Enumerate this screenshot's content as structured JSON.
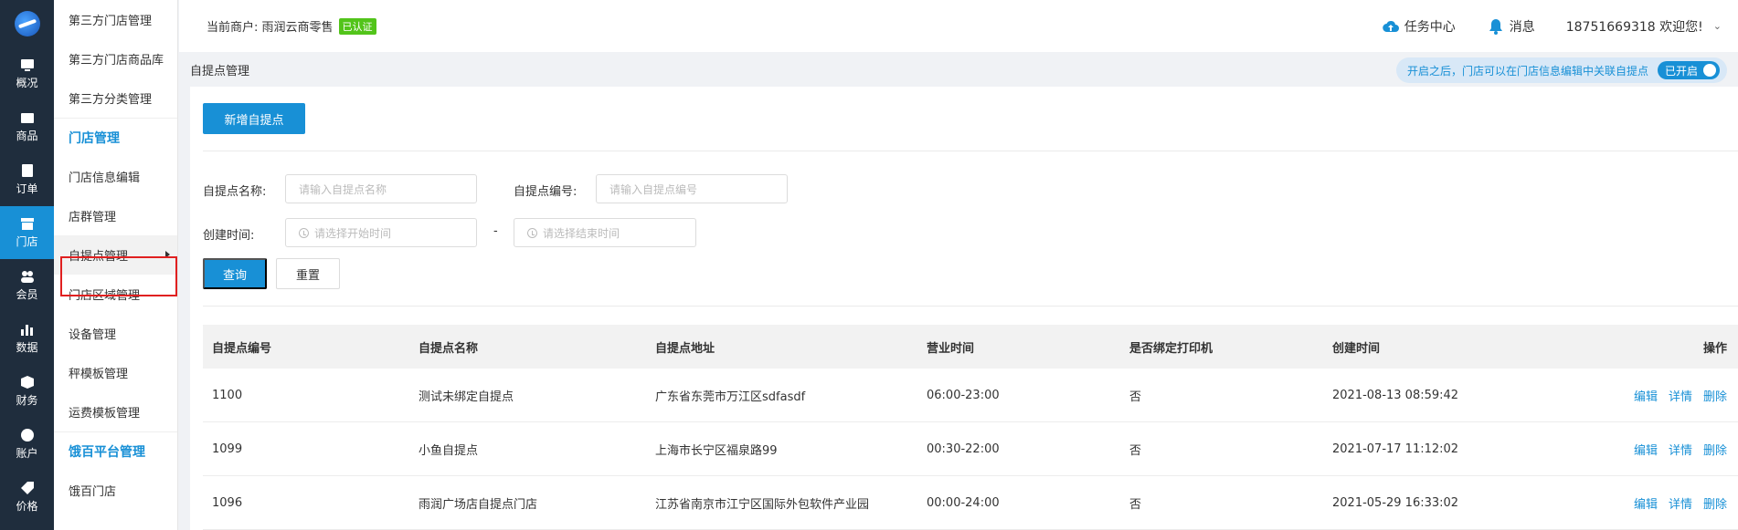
{
  "rail": {
    "items": [
      {
        "label": "概况",
        "icon": "overview-icon"
      },
      {
        "label": "商品",
        "icon": "goods-icon"
      },
      {
        "label": "订单",
        "icon": "order-icon"
      },
      {
        "label": "门店",
        "icon": "store-icon",
        "active": true
      },
      {
        "label": "会员",
        "icon": "member-icon"
      },
      {
        "label": "数据",
        "icon": "data-icon"
      },
      {
        "label": "财务",
        "icon": "finance-icon"
      },
      {
        "label": "账户",
        "icon": "account-icon"
      },
      {
        "label": "价格",
        "icon": "price-icon"
      }
    ]
  },
  "submenu": {
    "item0": "第三方门店管理",
    "item1": "第三方门店商品库",
    "item2": "第三方分类管理",
    "group1": "门店管理",
    "item3": "门店信息编辑",
    "item4": "店群管理",
    "item5": "自提点管理",
    "item6": "门店区域管理",
    "item7": "设备管理",
    "item8": "秤模板管理",
    "item9": "运费模板管理",
    "group2": "饿百平台管理",
    "item10": "饿百门店"
  },
  "topbar": {
    "merchant_label": "当前商户: 雨润云商零售",
    "verified": "已认证",
    "task_center": "任务中心",
    "messages": "消息",
    "user_greeting": "18751669318 欢迎您!"
  },
  "breadcrumb": {
    "title": "自提点管理",
    "notice": "开启之后，门店可以在门店信息编辑中关联自提点",
    "switch_label": "已开启"
  },
  "actions": {
    "add_button": "新增自提点",
    "query_button": "查询",
    "reset_button": "重置"
  },
  "filters": {
    "name_label": "自提点名称:",
    "name_placeholder": "请输入自提点名称",
    "code_label": "自提点编号:",
    "code_placeholder": "请输入自提点编号",
    "time_label": "创建时间:",
    "start_placeholder": "请选择开始时间",
    "end_placeholder": "请选择结束时间",
    "range_sep": "-"
  },
  "table": {
    "headers": {
      "code": "自提点编号",
      "name": "自提点名称",
      "address": "自提点地址",
      "hours": "营业时间",
      "printer": "是否绑定打印机",
      "created": "创建时间",
      "ops": "操作"
    },
    "op_labels": {
      "edit": "编辑",
      "detail": "详情",
      "delete": "删除"
    },
    "rows": [
      {
        "code": "1100",
        "name": "测试未绑定自提点",
        "address": "广东省东莞市万江区sdfasdf",
        "hours": "06:00-23:00",
        "printer": "否",
        "created": "2021-08-13 08:59:42"
      },
      {
        "code": "1099",
        "name": "小鱼自提点",
        "address": "上海市长宁区福泉路99",
        "hours": "00:30-22:00",
        "printer": "否",
        "created": "2021-07-17 11:12:02"
      },
      {
        "code": "1096",
        "name": "雨润广场店自提点门店",
        "address": "江苏省南京市江宁区国际外包软件产业园",
        "hours": "00:00-24:00",
        "printer": "否",
        "created": "2021-05-29 16:33:02"
      }
    ]
  }
}
